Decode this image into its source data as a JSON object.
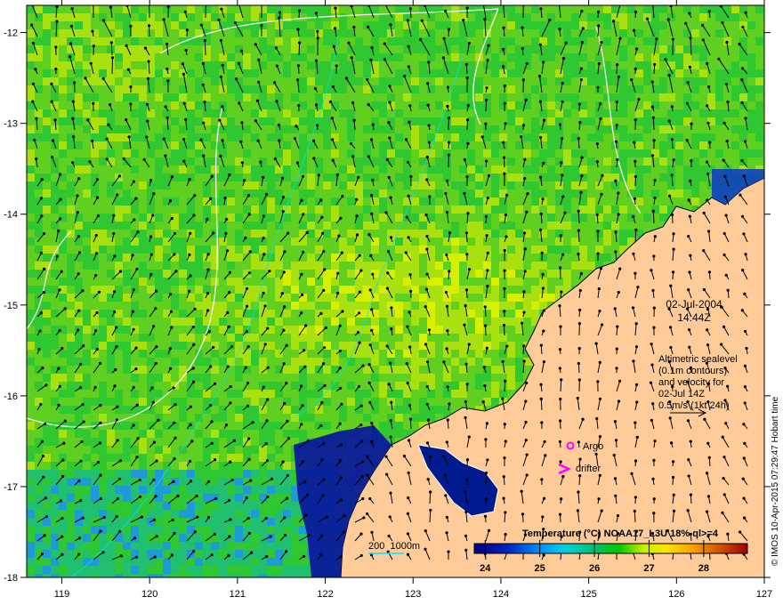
{
  "map": {
    "lon_ticks": [
      "119",
      "120",
      "121",
      "122",
      "123",
      "124",
      "125",
      "126",
      "127"
    ],
    "lat_ticks": [
      "-12",
      "-13",
      "-14",
      "-15",
      "-16",
      "-17",
      "-18"
    ],
    "lon_range": [
      118.6,
      127
    ],
    "lat_range": [
      -18,
      -11.7
    ]
  },
  "annotation": {
    "date": "02-Jul-2004",
    "time": "14:44Z",
    "legend_lines": [
      "Altimetric sealevel",
      "(0.1m contours)",
      "and velocity for",
      "02-Jul 14Z",
      "0.5m/s (1kt 24h)"
    ],
    "argo_label": "Argo",
    "drifter_label": "drifter",
    "bathy_label": "200  1000m"
  },
  "colorbar": {
    "title": "Temperature (°C) NOAA17_L3U 18% ql>=4",
    "ticks": [
      "24",
      "25",
      "26",
      "27",
      "28"
    ],
    "range": [
      23.8,
      28.8
    ]
  },
  "credit": "© IMOS 10-Apr-2015 07:29:47 Hobart time",
  "colors": {
    "land": "#ffcc99",
    "argo": "#ff00ff",
    "drifter": "#ff00ff",
    "bathy": "#00e5ff"
  }
}
